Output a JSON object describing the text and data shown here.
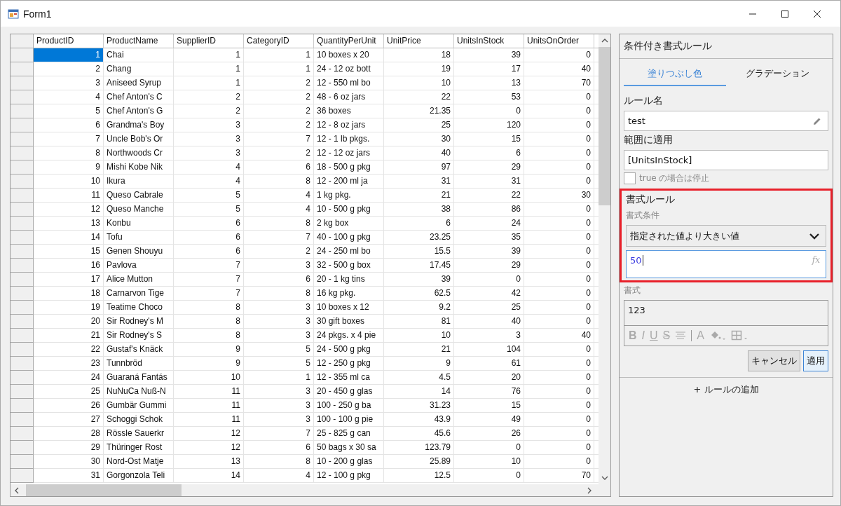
{
  "window": {
    "title": "Form1"
  },
  "grid": {
    "columns": [
      {
        "label": "ProductID",
        "kind": "number"
      },
      {
        "label": "ProductName",
        "kind": "text"
      },
      {
        "label": "SupplierID",
        "kind": "number"
      },
      {
        "label": "CategoryID",
        "kind": "number"
      },
      {
        "label": "QuantityPerUnit",
        "kind": "text"
      },
      {
        "label": "UnitPrice",
        "kind": "number"
      },
      {
        "label": "UnitsInStock",
        "kind": "number"
      },
      {
        "label": "UnitsOnOrder",
        "kind": "number"
      }
    ],
    "rows": [
      {
        "selected": true,
        "cells": [
          "1",
          "Chai",
          "1",
          "1",
          "10 boxes x 20",
          "18",
          "39",
          "0"
        ]
      },
      {
        "selected": false,
        "cells": [
          "2",
          "Chang",
          "1",
          "1",
          "24 - 12 oz bott",
          "19",
          "17",
          "40"
        ]
      },
      {
        "selected": false,
        "cells": [
          "3",
          "Aniseed Syrup",
          "1",
          "2",
          "12 - 550 ml bo",
          "10",
          "13",
          "70"
        ]
      },
      {
        "selected": false,
        "cells": [
          "4",
          "Chef Anton's C",
          "2",
          "2",
          "48 - 6 oz jars",
          "22",
          "53",
          "0"
        ]
      },
      {
        "selected": false,
        "cells": [
          "5",
          "Chef Anton's G",
          "2",
          "2",
          "36 boxes",
          "21.35",
          "0",
          "0"
        ]
      },
      {
        "selected": false,
        "cells": [
          "6",
          "Grandma's Boy",
          "3",
          "2",
          "12 - 8 oz jars",
          "25",
          "120",
          "0"
        ]
      },
      {
        "selected": false,
        "cells": [
          "7",
          "Uncle Bob's Or",
          "3",
          "7",
          "12 - 1 lb pkgs.",
          "30",
          "15",
          "0"
        ]
      },
      {
        "selected": false,
        "cells": [
          "8",
          "Northwoods Cr",
          "3",
          "2",
          "12 - 12 oz jars",
          "40",
          "6",
          "0"
        ]
      },
      {
        "selected": false,
        "cells": [
          "9",
          "Mishi Kobe Nik",
          "4",
          "6",
          "18 - 500 g pkg",
          "97",
          "29",
          "0"
        ]
      },
      {
        "selected": false,
        "cells": [
          "10",
          "Ikura",
          "4",
          "8",
          "12 - 200 ml ja",
          "31",
          "31",
          "0"
        ]
      },
      {
        "selected": false,
        "cells": [
          "11",
          "Queso Cabrale",
          "5",
          "4",
          "1 kg pkg.",
          "21",
          "22",
          "30"
        ]
      },
      {
        "selected": false,
        "cells": [
          "12",
          "Queso Manche",
          "5",
          "4",
          "10 - 500 g pkg",
          "38",
          "86",
          "0"
        ]
      },
      {
        "selected": false,
        "cells": [
          "13",
          "Konbu",
          "6",
          "8",
          "2 kg box",
          "6",
          "24",
          "0"
        ]
      },
      {
        "selected": false,
        "cells": [
          "14",
          "Tofu",
          "6",
          "7",
          "40 - 100 g pkg",
          "23.25",
          "35",
          "0"
        ]
      },
      {
        "selected": false,
        "cells": [
          "15",
          "Genen Shouyu",
          "6",
          "2",
          "24 - 250 ml bo",
          "15.5",
          "39",
          "0"
        ]
      },
      {
        "selected": false,
        "cells": [
          "16",
          "Pavlova",
          "7",
          "3",
          "32 - 500 g box",
          "17.45",
          "29",
          "0"
        ]
      },
      {
        "selected": false,
        "cells": [
          "17",
          "Alice Mutton",
          "7",
          "6",
          "20 - 1 kg tins",
          "39",
          "0",
          "0"
        ]
      },
      {
        "selected": false,
        "cells": [
          "18",
          "Carnarvon Tige",
          "7",
          "8",
          "16 kg pkg.",
          "62.5",
          "42",
          "0"
        ]
      },
      {
        "selected": false,
        "cells": [
          "19",
          "Teatime Choco",
          "8",
          "3",
          "10 boxes x 12",
          "9.2",
          "25",
          "0"
        ]
      },
      {
        "selected": false,
        "cells": [
          "20",
          "Sir Rodney's M",
          "8",
          "3",
          "30 gift boxes",
          "81",
          "40",
          "0"
        ]
      },
      {
        "selected": false,
        "cells": [
          "21",
          "Sir Rodney's S",
          "8",
          "3",
          "24 pkgs. x 4 pie",
          "10",
          "3",
          "40"
        ]
      },
      {
        "selected": false,
        "cells": [
          "22",
          "Gustaf's Knäck",
          "9",
          "5",
          "24 - 500 g pkg",
          "21",
          "104",
          "0"
        ]
      },
      {
        "selected": false,
        "cells": [
          "23",
          "Tunnbröd",
          "9",
          "5",
          "12 - 250 g pkg",
          "9",
          "61",
          "0"
        ]
      },
      {
        "selected": false,
        "cells": [
          "24",
          "Guaraná Fantás",
          "10",
          "1",
          "12 - 355 ml ca",
          "4.5",
          "20",
          "0"
        ]
      },
      {
        "selected": false,
        "cells": [
          "25",
          "NuNuCa Nuß-N",
          "11",
          "3",
          "20 - 450 g glas",
          "14",
          "76",
          "0"
        ]
      },
      {
        "selected": false,
        "cells": [
          "26",
          "Gumbär Gummi",
          "11",
          "3",
          "100 - 250 g ba",
          "31.23",
          "15",
          "0"
        ]
      },
      {
        "selected": false,
        "cells": [
          "27",
          "Schoggi Schok",
          "11",
          "3",
          "100 - 100 g pie",
          "43.9",
          "49",
          "0"
        ]
      },
      {
        "selected": false,
        "cells": [
          "28",
          "Rössle Sauerkr",
          "12",
          "7",
          "25 - 825 g can",
          "45.6",
          "26",
          "0"
        ]
      },
      {
        "selected": false,
        "cells": [
          "29",
          "Thüringer Rost",
          "12",
          "6",
          "50 bags x 30 sa",
          "123.79",
          "0",
          "0"
        ]
      },
      {
        "selected": false,
        "cells": [
          "30",
          "Nord-Ost Matje",
          "13",
          "8",
          "10 - 200 g glas",
          "25.89",
          "10",
          "0"
        ]
      },
      {
        "selected": false,
        "cells": [
          "31",
          "Gorgonzola Teli",
          "14",
          "4",
          "12 - 100 g pkg",
          "12.5",
          "0",
          "70"
        ]
      }
    ]
  },
  "panel": {
    "title": "条件付き書式ルール",
    "tabs": [
      {
        "label": "塗りつぶし色",
        "selected": true
      },
      {
        "label": "グラデーション",
        "selected": false
      }
    ],
    "rule_name": {
      "label": "ルール名",
      "value": "test"
    },
    "range": {
      "label": "範囲に適用",
      "value": "[UnitsInStock]"
    },
    "stop_if_true": {
      "label": "true の場合は停止",
      "checked": false
    },
    "format_rule": {
      "highlighted": true,
      "title": "書式ルール",
      "condition_label": "書式条件",
      "condition": "指定された値より大きい値",
      "value": "50",
      "fx_icon": "fx"
    },
    "format": {
      "label": "書式",
      "preview": "123",
      "toolbar": [
        {
          "kind": "bold",
          "label": "B"
        },
        {
          "kind": "italic",
          "label": "I"
        },
        {
          "kind": "underline",
          "label": "U"
        },
        {
          "kind": "strike",
          "label": "S"
        },
        {
          "kind": "align"
        },
        {
          "kind": "separator"
        },
        {
          "kind": "fontcolor",
          "label": "A"
        },
        {
          "kind": "fill"
        },
        {
          "kind": "border"
        }
      ]
    },
    "buttons": [
      {
        "label": "キャンセル",
        "primary": false
      },
      {
        "label": "適用",
        "primary": true
      }
    ],
    "add_rule": "+ ルールの追加"
  }
}
